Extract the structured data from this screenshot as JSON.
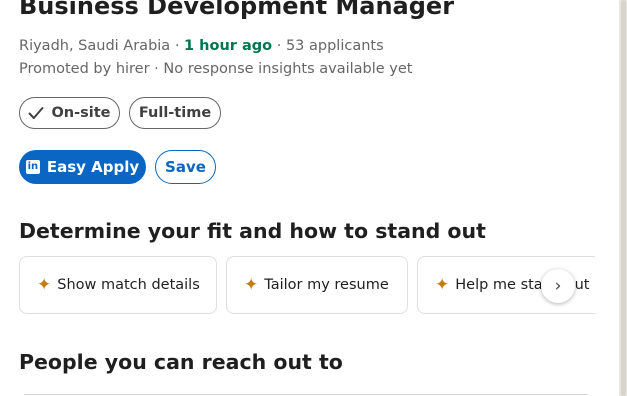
{
  "job": {
    "title": "Business Development Manager",
    "location": "Riyadh, Saudi Arabia",
    "separator": "·",
    "posted": "1 hour ago",
    "applicants": "53 applicants",
    "promoted_by": "Promoted by hirer",
    "response_insights": "No response insights available yet"
  },
  "tags": [
    {
      "label": "On-site",
      "icon": "check-icon",
      "selected": true
    },
    {
      "label": "Full-time"
    }
  ],
  "actions": {
    "easy_apply_label": "Easy Apply",
    "easy_apply_icon": "in",
    "save_label": "Save"
  },
  "fit_section": {
    "title": "Determine your fit and how to stand out",
    "chips": [
      {
        "label": "Show match details",
        "icon": "sparkle-icon"
      },
      {
        "label": "Tailor my resume",
        "icon": "sparkle-icon"
      },
      {
        "label": "Help me stand out",
        "icon": "sparkle-icon"
      }
    ],
    "next_icon": "›"
  },
  "people_section": {
    "title": "People you can reach out to"
  },
  "colors": {
    "primary": "#0a66c2",
    "posted_green": "#01754f",
    "sparkle": "#c37d16",
    "text_dark": "#1f1f1f",
    "text_muted": "#666666"
  }
}
